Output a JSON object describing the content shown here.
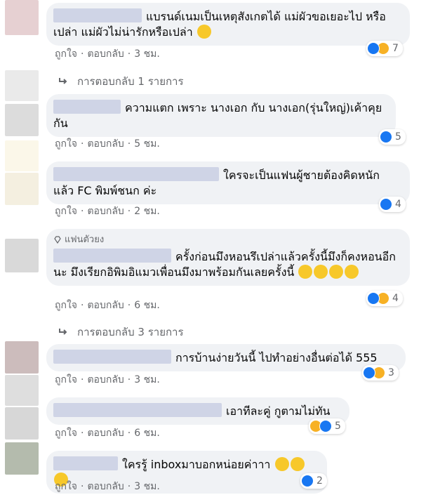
{
  "comments": [
    {
      "avatar_color": "#e6d0d2",
      "text": "แบรนด์เนมเป็นเหตุสังเกตได้ แม่ผัวขอเยอะไป หรือเปล่า แม่ผัวไม่น่ารักหรือเปล่า",
      "like": "ถูกใจ",
      "reply": "ตอบกลับ",
      "time": "3 ชม.",
      "reaction_count": "7"
    },
    {
      "avatar_color": "#dcdcdc",
      "text": "ความแตก เพราะ นางเอก กับ นางเอก(รุ่นใหญ่)เค้าคุยกัน",
      "like": "ถูกใจ",
      "reply": "ตอบกลับ",
      "time": "5 ชม.",
      "reaction_count": "5"
    },
    {
      "avatar_color": "#f4efe0",
      "text": "ใครจะเป็นแฟนผู้ชายต้องคิดหนัก แล้ว FC พิมพ์ชนก ค่ะ",
      "like": "ถูกใจ",
      "reply": "ตอบกลับ",
      "time": "2 ชม.",
      "reaction_count": "4"
    },
    {
      "avatar_color": "#d9d9d9",
      "badge": "แฟนตัวยง",
      "text": "ครั้งก่อนมึงหอนรึเปล่าแล้วครั้งนี้มึงก็คงหอนอีกนะ มึงเรียกอิพิมอิแมวเพื่อนมึงมาพร้อมกันเลยครั้งนี้",
      "like": "ถูกใจ",
      "reply": "ตอบกลับ",
      "time": "6 ชม.",
      "reaction_count": "4"
    },
    {
      "avatar_color": "#ccbcbc",
      "text": "การบ้านง่ายวันนี้ ไปทำอย่างอื่นต่อได้ 555",
      "like": "ถูกใจ",
      "reply": "ตอบกลับ",
      "time": "3 ชม.",
      "reaction_count": "3"
    },
    {
      "avatar_color": "#d7d7d7",
      "text": "เอาทีละคู่ กูตามไม่ทัน",
      "like": "ถูกใจ",
      "reply": "ตอบกลับ",
      "time": "6 ชม.",
      "reaction_count": "5"
    },
    {
      "avatar_color": "#b4bbad",
      "text": "ใครรู้ inboxมาบอกหน่อยค่าาา",
      "like": "ถูกใจ",
      "reply": "ตอบกลับ",
      "time": "3 ชม.",
      "reaction_count": "2"
    }
  ],
  "reply_links": [
    "การตอบกลับ 1 รายการ",
    "การตอบกลับ 3 รายการ"
  ],
  "colors": {
    "like": "#1877f2",
    "haha": "#f7b125",
    "bubble": "#f0f2f5",
    "meta": "#65676b"
  }
}
